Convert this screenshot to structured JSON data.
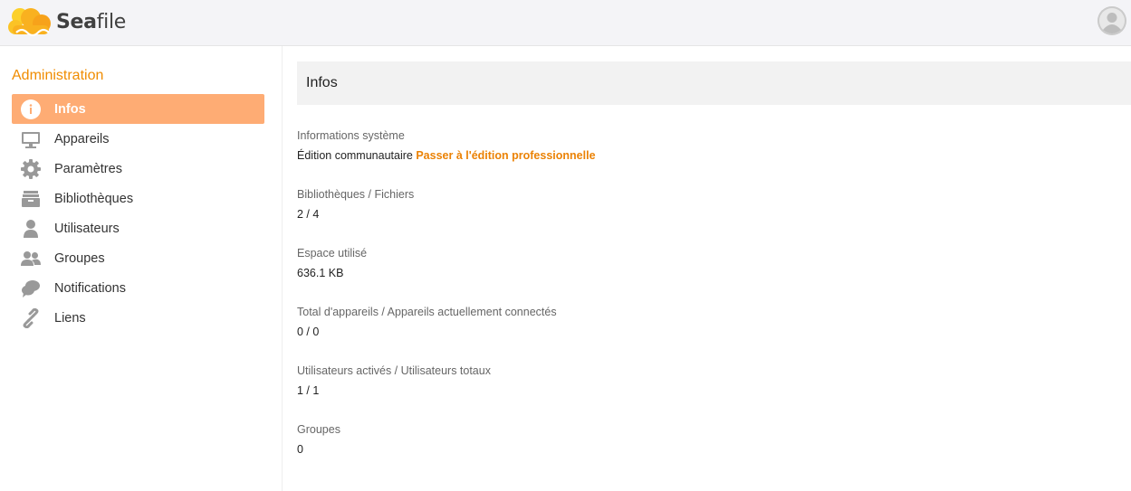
{
  "header": {
    "logo_text_bold": "Sea",
    "logo_text_thin": "file",
    "brand_color": "#f9a81a",
    "avatar_icon": "user-avatar-icon"
  },
  "sidebar": {
    "title": "Administration",
    "items": [
      {
        "label": "Infos",
        "icon": "info-icon",
        "active": true
      },
      {
        "label": "Appareils",
        "icon": "desktop-icon"
      },
      {
        "label": "Paramètres",
        "icon": "gear-icon"
      },
      {
        "label": "Bibliothèques",
        "icon": "library-icon"
      },
      {
        "label": "Utilisateurs",
        "icon": "user-icon"
      },
      {
        "label": "Groupes",
        "icon": "group-icon"
      },
      {
        "label": "Notifications",
        "icon": "chat-icon"
      },
      {
        "label": "Liens",
        "icon": "link-icon"
      }
    ],
    "active_color": "#feac74"
  },
  "main": {
    "title": "Infos",
    "fields": [
      {
        "label": "Informations système",
        "value": "Édition communautaire",
        "link": "Passer à l'édition professionnelle"
      },
      {
        "label": "Bibliothèques / Fichiers",
        "value": "2 / 4"
      },
      {
        "label": "Espace utilisé",
        "value": "636.1 KB"
      },
      {
        "label": "Total d'appareils / Appareils actuellement connectés",
        "value": "0 / 0"
      },
      {
        "label": "Utilisateurs activés / Utilisateurs totaux",
        "value": "1 / 1"
      },
      {
        "label": "Groupes",
        "value": "0"
      }
    ],
    "link_color": "#eb8205"
  }
}
